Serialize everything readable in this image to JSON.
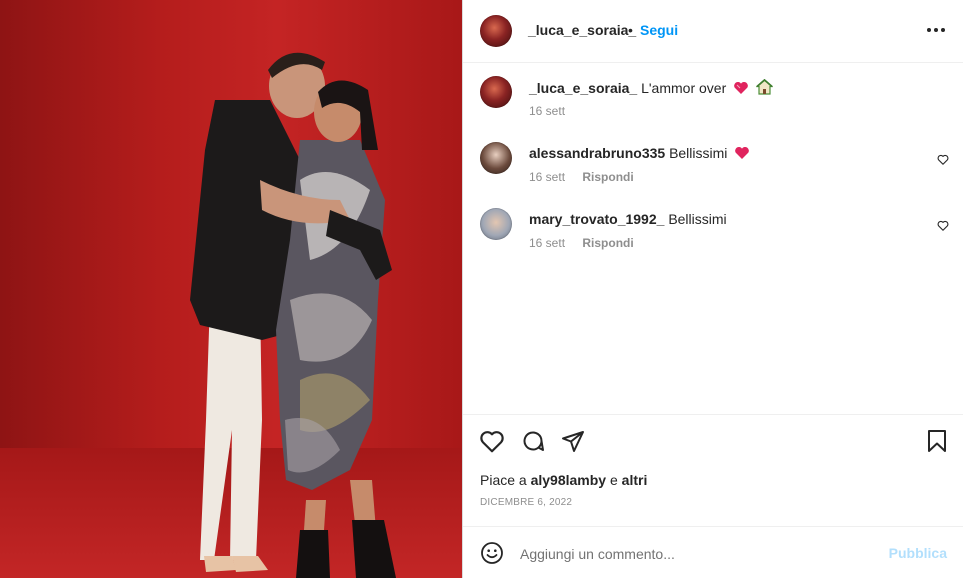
{
  "post": {
    "author": "_luca_e_soraia_",
    "follow_label": "Segui",
    "separator": "•",
    "caption": {
      "username": "_luca_e_soraia_",
      "text": "L'ammor over",
      "time": "16 sett"
    },
    "comments": [
      {
        "username": "alessandrabruno335",
        "text": "Bellissimi",
        "time": "16 sett",
        "reply_label": "Rispondi"
      },
      {
        "username": "mary_trovato_1992_",
        "text": "Bellissimi",
        "time": "16 sett",
        "reply_label": "Rispondi"
      }
    ],
    "likes": {
      "prefix": "Piace a",
      "user": "aly98lamby",
      "joiner": "e",
      "others": "altri"
    },
    "date": "DICEMBRE 6, 2022",
    "add_comment": {
      "placeholder": "Aggiungi un commento...",
      "publish_label": "Pubblica"
    }
  },
  "colors": {
    "accent": "#0095f6",
    "publish_disabled": "#b2dffc",
    "heart_emoji": "#e0245e",
    "photo_background": "#b51d1c"
  },
  "icons": {
    "more": "more-options-icon",
    "like": "heart-outline-icon",
    "comment": "comment-bubble-icon",
    "share": "paper-plane-icon",
    "save": "bookmark-icon",
    "emoji": "smiley-face-icon",
    "caption_emojis": [
      "red-heart-emoji",
      "house-emoji"
    ]
  }
}
